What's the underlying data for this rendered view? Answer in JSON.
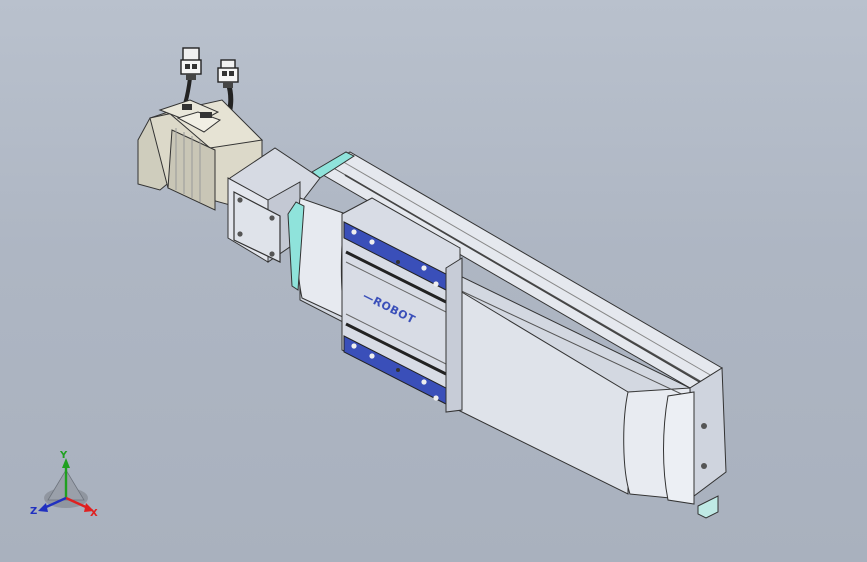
{
  "colors": {
    "background": "#b0b8c5",
    "rail": "#d9dde6",
    "motor": "#d8d6c6",
    "accent_cyan": "#7fe0d8",
    "plate_blue": "#3b4fb8",
    "axis_x": "#e02020",
    "axis_y": "#20a020",
    "axis_z": "#2030c0"
  },
  "model": {
    "logo_text": "—ROBOT"
  },
  "triad": {
    "x_label": "X",
    "y_label": "Y",
    "z_label": "Z"
  }
}
